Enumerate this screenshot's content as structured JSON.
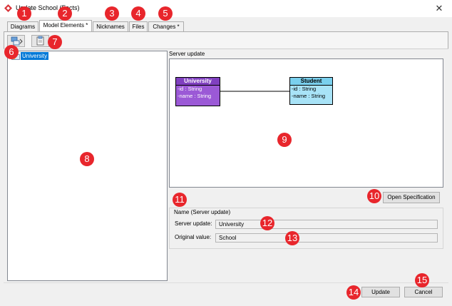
{
  "window": {
    "title": "Update School (Facts)",
    "close_glyph": "✕"
  },
  "tabs": [
    {
      "label": "Diagrams"
    },
    {
      "label": "Model Elements *"
    },
    {
      "label": "Nicknames"
    },
    {
      "label": "Files"
    },
    {
      "label": "Changes *"
    }
  ],
  "tree": {
    "items": [
      {
        "label": "University",
        "icon": "package-icon"
      }
    ]
  },
  "server_update": {
    "section_label": "Server update",
    "classes": [
      {
        "name": "University",
        "attributes": [
          "-id : String",
          "-name : String"
        ],
        "header_color": "#8040c0",
        "body_color": "#9b59d6"
      },
      {
        "name": "Student",
        "attributes": [
          "-id : String",
          "-name : String"
        ],
        "header_color": "#7ad0ee",
        "body_color": "#a8e3f7"
      }
    ],
    "open_spec_label": "Open Specification"
  },
  "name_group": {
    "title": "Name (Server update)",
    "server_label": "Server update:",
    "server_value": "University",
    "original_label": "Original value:",
    "original_value": "School"
  },
  "actions": {
    "update_label": "Update",
    "cancel_label": "Cancel"
  },
  "badges": [
    "1",
    "2",
    "3",
    "4",
    "5",
    "6",
    "7",
    "8",
    "9",
    "10",
    "11",
    "12",
    "13",
    "14",
    "15"
  ],
  "colors": {
    "badge": "#e8262c",
    "selection": "#0078d7"
  }
}
